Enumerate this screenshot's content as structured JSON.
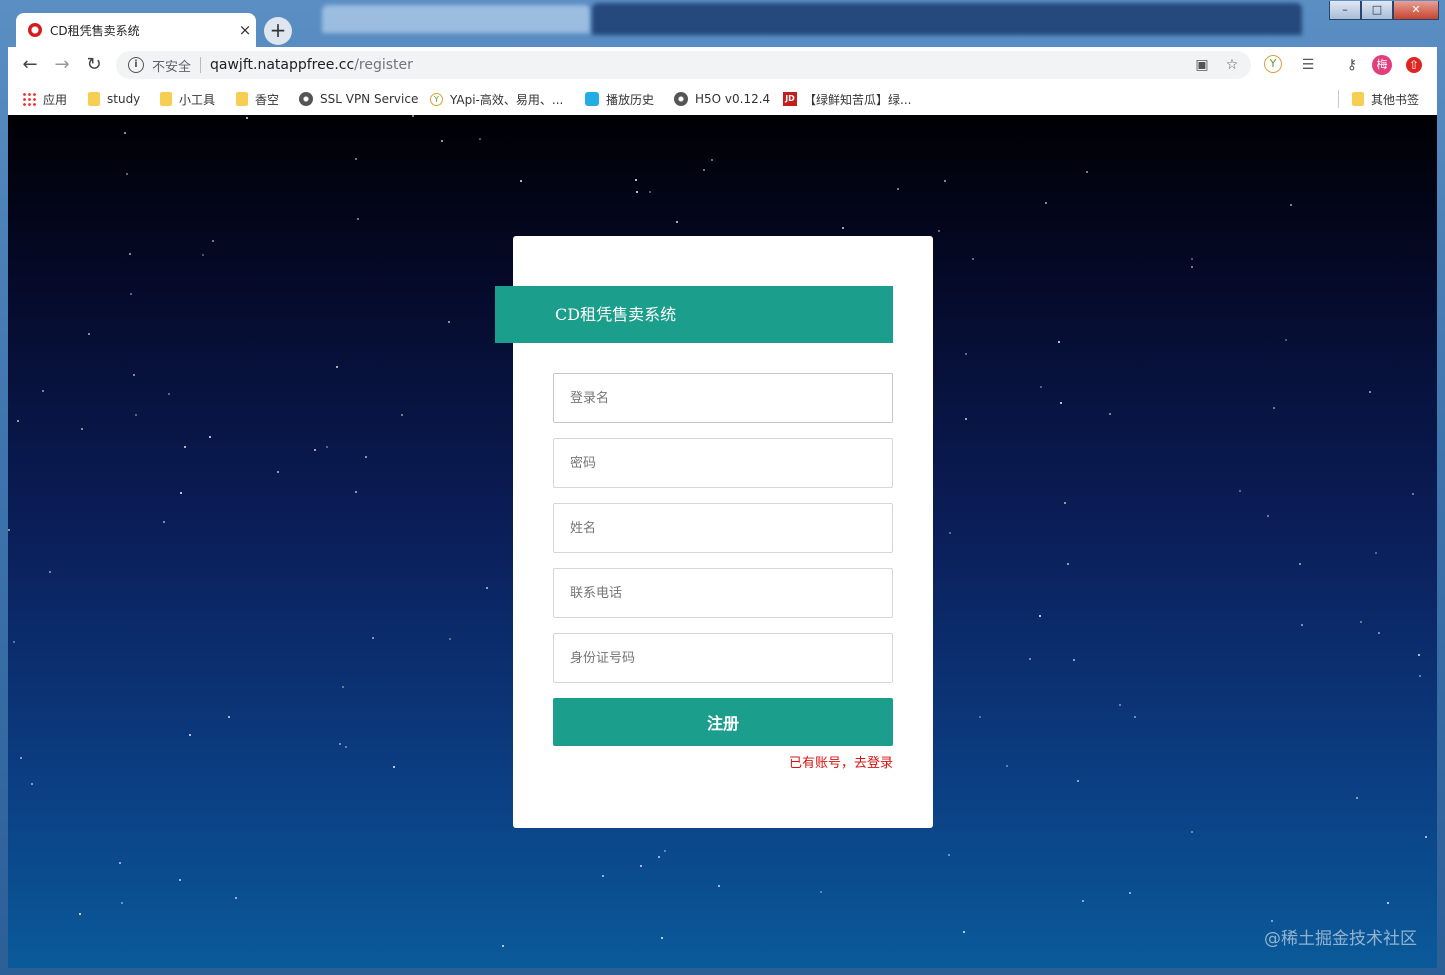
{
  "window": {
    "controls": [
      "–",
      "□",
      "✕"
    ]
  },
  "tabs": {
    "active_title": "CD租凭售卖系统",
    "close_glyph": "×",
    "new_tab_glyph": "+"
  },
  "toolbar": {
    "security_label": "不安全",
    "url_host": "qawjft.natappfree.cc",
    "url_path": "/register",
    "profile_initial": "梅"
  },
  "bookmarks": [
    {
      "label": "应用",
      "icon": "apps-icon"
    },
    {
      "label": "study",
      "icon": "folder-icon"
    },
    {
      "label": "小工具",
      "icon": "folder-icon"
    },
    {
      "label": "香空",
      "icon": "folder-icon"
    },
    {
      "label": "SSL VPN Service",
      "icon": "globe-icon"
    },
    {
      "label": "YApi-高效、易用、...",
      "icon": "yapi-icon"
    },
    {
      "label": "播放历史",
      "icon": "bilibili-icon"
    },
    {
      "label": "H5O v0.12.4",
      "icon": "globe-icon"
    },
    {
      "label": "【绿鲜知苦瓜】绿...",
      "icon": "jd-icon"
    }
  ],
  "other_bookmarks": "其他书签",
  "page": {
    "banner_title": "CD租凭售卖系统",
    "fields": {
      "username_placeholder": "登录名",
      "password_placeholder": "密码",
      "name_placeholder": "姓名",
      "phone_placeholder": "联系电话",
      "idcard_placeholder": "身份证号码"
    },
    "register_button": "注册",
    "login_link": "已有账号，去登录"
  },
  "watermark": "@稀土掘金技术社区",
  "colors": {
    "accent": "#1c9e8d",
    "link_red": "#d9140f"
  }
}
